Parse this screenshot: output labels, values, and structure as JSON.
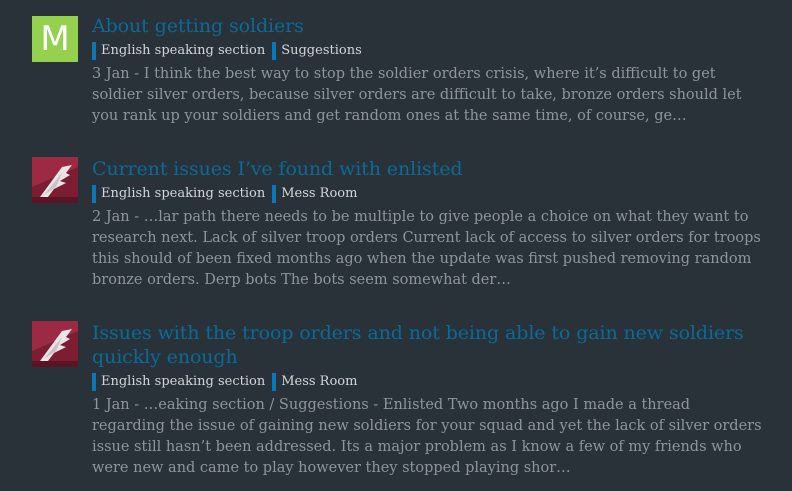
{
  "results": [
    {
      "avatar_letter": "M",
      "title": "About getting soldiers",
      "tags": [
        "English speaking section",
        "Suggestions"
      ],
      "date": "3 Jan",
      "excerpt": " - I think the best way to stop the soldier orders crisis, where it’s difficult to get soldier silver orders, because silver orders are difficult to take, bronze orders should let you rank up your soldiers and get random ones at the same time, of course, ge…"
    },
    {
      "avatar_letter": "",
      "title": "Current issues I’ve found with enlisted",
      "tags": [
        "English speaking section",
        "Mess Room"
      ],
      "date": "2 Jan",
      "excerpt": " - …lar path there needs to be multiple to give people a choice on what they want to research next. Lack of silver troop orders Current lack of access to silver orders for troops this should of been fixed months ago when the update was first pushed removing random bronze orders. Derp bots The bots seem somewhat der…"
    },
    {
      "avatar_letter": "",
      "title": "Issues with the troop orders and not being able to gain new soldiers quickly enough",
      "tags": [
        "English speaking section",
        "Mess Room"
      ],
      "date": "1 Jan",
      "excerpt": " - …eaking section / Suggestions - Enlisted Two months ago I made a thread regarding the issue of gaining new soldiers for your squad and yet the lack of silver orders issue still hasn’t been addressed. Its a major problem as I know a few of my friends who were new and came to play however they stopped playing shor…"
    }
  ]
}
